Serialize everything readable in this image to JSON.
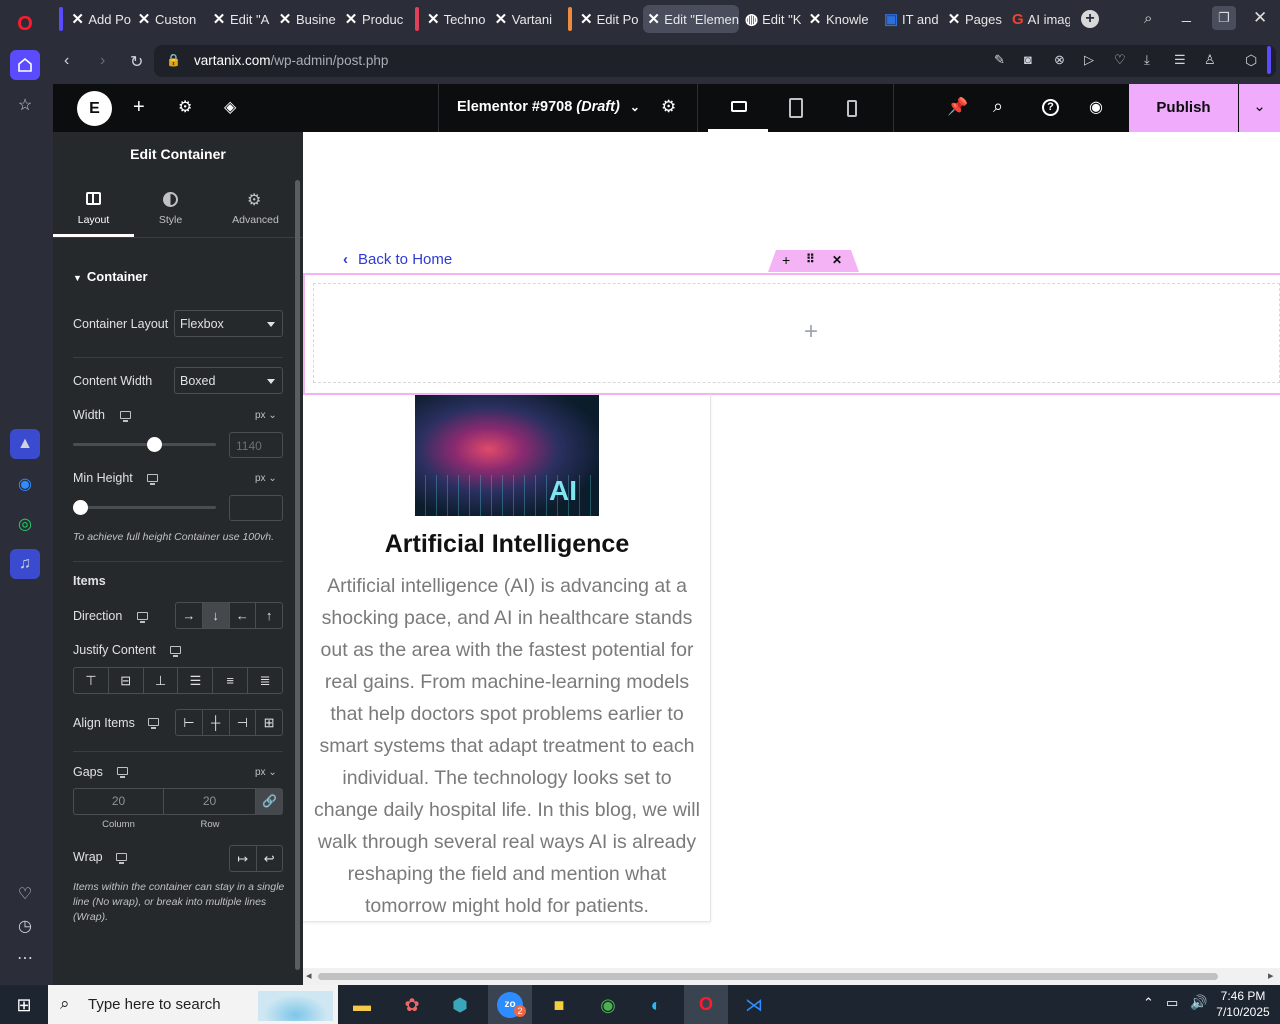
{
  "browser": {
    "tabs": [
      {
        "label": "Add Po",
        "icon": "elementor-x-icon"
      },
      {
        "label": "Custon",
        "icon": "elementor-x-icon"
      },
      {
        "label": "Edit \"A",
        "icon": "elementor-x-icon"
      },
      {
        "label": "Busine",
        "icon": "elementor-x-icon"
      },
      {
        "label": "Produc",
        "icon": "elementor-x-icon"
      },
      {
        "label": "Techno",
        "icon": "elementor-x-icon"
      },
      {
        "label": "Vartani",
        "icon": "elementor-x-icon"
      },
      {
        "label": "Edit Po",
        "icon": "elementor-x-icon"
      },
      {
        "label": "Edit \"Elemen",
        "icon": "elementor-x-icon",
        "active": true
      },
      {
        "label": "Edit \"K",
        "icon": "wordpress-icon"
      },
      {
        "label": "Knowle",
        "icon": "elementor-x-icon"
      },
      {
        "label": "IT and",
        "icon": "site-icon"
      },
      {
        "label": "Pages",
        "icon": "elementor-x-icon"
      },
      {
        "label": "AI imag",
        "icon": "google-icon"
      }
    ],
    "url_domain": "vartanix.com",
    "url_path": "/wp-admin/post.php"
  },
  "elementor": {
    "doc_title": "Elementor #9708",
    "doc_status": "(Draft)",
    "publish_label": "Publish",
    "panel_title": "Edit Container",
    "tabs": [
      {
        "label": "Layout",
        "icon": "layout-icon"
      },
      {
        "label": "Style",
        "icon": "style-icon"
      },
      {
        "label": "Advanced",
        "icon": "gear-icon"
      }
    ],
    "section_title": "Container",
    "container_layout": {
      "label": "Container Layout",
      "value": "Flexbox"
    },
    "content_width": {
      "label": "Content Width",
      "value": "Boxed"
    },
    "width": {
      "label": "Width",
      "unit": "px",
      "placeholder": "1140",
      "slider_fraction": 0.57
    },
    "min_height": {
      "label": "Min Height",
      "unit": "px",
      "value": "",
      "slider_fraction": 0.0
    },
    "min_height_note": "To achieve full height Container use 100vh.",
    "items_heading": "Items",
    "direction_label": "Direction",
    "direction_options": [
      "→",
      "↓",
      "←",
      "↑"
    ],
    "justify_label": "Justify Content",
    "align_label": "Align Items",
    "gaps": {
      "label": "Gaps",
      "unit": "px",
      "column_value": "20",
      "row_value": "20",
      "column_label": "Column",
      "row_label": "Row"
    },
    "wrap_label": "Wrap",
    "wrap_note": "Items within the container can stay in a single line (No wrap), or break into multiple lines (Wrap)."
  },
  "canvas": {
    "back_link": "Back to Home",
    "image_text": "AI",
    "heading": "Artificial Intelligence",
    "body_lines": [
      "Artificial intelligence (AI) is advancing at a",
      "shocking pace, and AI in healthcare stands",
      "out as the area with the fastest potential for",
      "real gains. From machine-learning models",
      "that help doctors spot problems earlier to",
      "smart systems that adapt treatment to each",
      "individual. The technology looks set to",
      "change daily hospital life. In this blog, we will",
      "walk through several real ways AI is already",
      "reshaping the field and mention what",
      "tomorrow might hold for patients."
    ]
  },
  "taskbar": {
    "search_placeholder": "Type here to search",
    "time": "7:46 PM",
    "date": "7/10/2025",
    "zoom_badge": "2"
  },
  "colors": {
    "publish_bg": "#f0abfc",
    "link_blue": "#2e3bd6",
    "selection_pink": "#f3b3f5"
  }
}
